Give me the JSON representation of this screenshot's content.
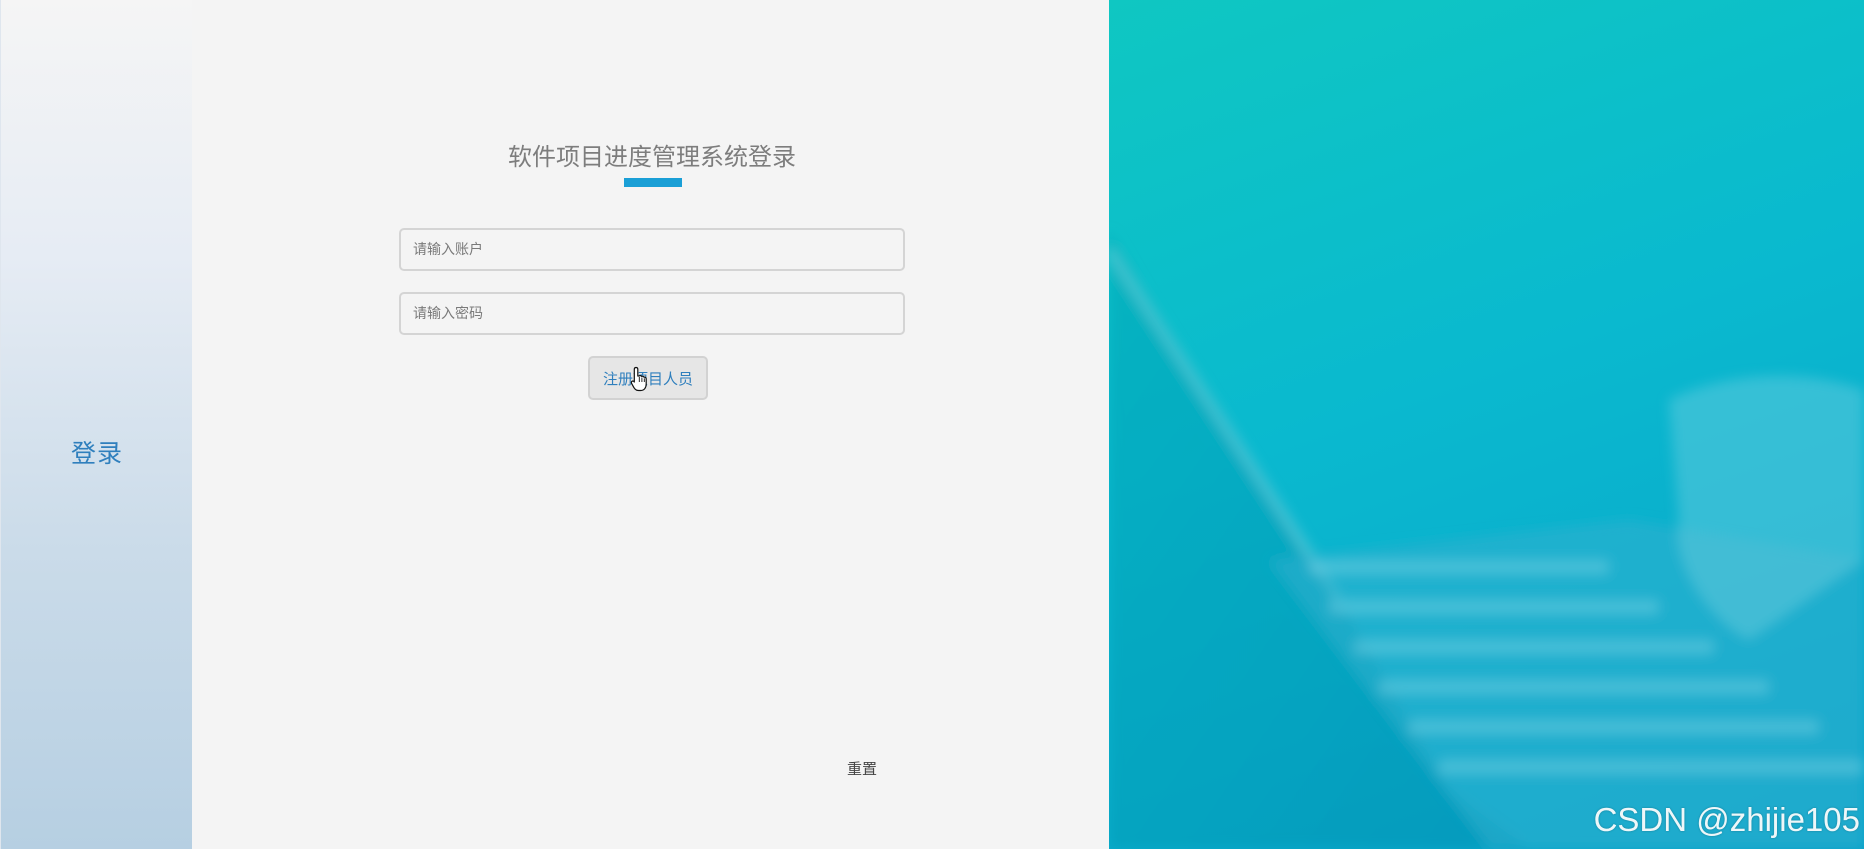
{
  "sidebar": {
    "title": "登录"
  },
  "login": {
    "title": "软件项目进度管理系统登录",
    "account_placeholder": "请输入账户",
    "password_placeholder": "请输入密码",
    "register_label": "注册项目人员",
    "reset_label": "重置"
  },
  "watermark": "CSDN @zhijie105",
  "colors": {
    "accent": "#1a9fd6",
    "link": "#2f7fbd",
    "hero_teal": "#0ab9cf"
  }
}
